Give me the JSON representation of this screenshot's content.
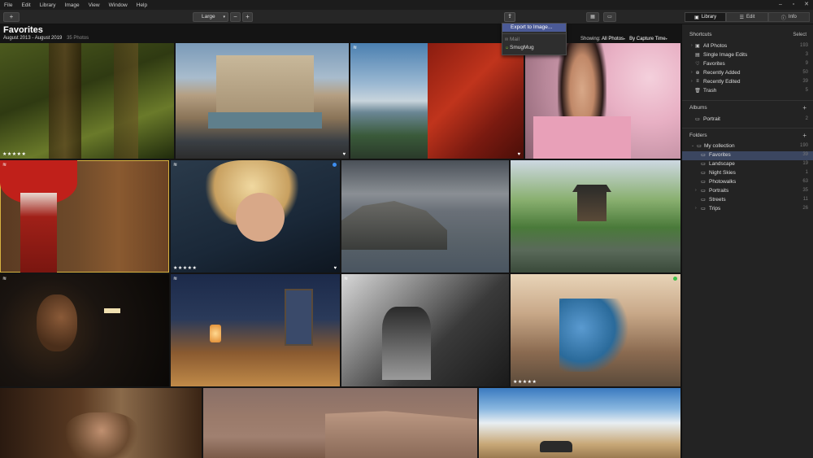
{
  "menubar": {
    "items": [
      "File",
      "Edit",
      "Library",
      "Image",
      "View",
      "Window",
      "Help"
    ]
  },
  "toolbar": {
    "add_label": "+",
    "size_value": "Large",
    "zoom_out": "−",
    "zoom_in": "+"
  },
  "tabs": [
    {
      "label": "Library",
      "icon": "library-icon"
    },
    {
      "label": "Edit",
      "icon": "sliders-icon"
    },
    {
      "label": "Info",
      "icon": "info-icon"
    }
  ],
  "header": {
    "title": "Favorites",
    "date_range": "August 2013 - August 2019",
    "count": "35 Photos",
    "showing_label": "Showing:",
    "showing_value": "All Photos",
    "sort_value": "By Capture Time"
  },
  "export_menu": {
    "items": [
      "Export to Image...",
      "Mail",
      "SmugMug"
    ]
  },
  "sidebar": {
    "shortcuts": {
      "title": "Shortcuts",
      "action": "Select",
      "items": [
        {
          "label": "All Photos",
          "count": "193"
        },
        {
          "label": "Single Image Edits",
          "count": "3"
        },
        {
          "label": "Favorites",
          "count": "9"
        },
        {
          "label": "Recently Added",
          "count": "50"
        },
        {
          "label": "Recently Edited",
          "count": "39"
        },
        {
          "label": "Trash",
          "count": "5"
        }
      ]
    },
    "albums": {
      "title": "Albums",
      "action": "+",
      "items": [
        {
          "label": "Portrait",
          "count": "2"
        }
      ]
    },
    "folders": {
      "title": "Folders",
      "action": "+",
      "items": [
        {
          "label": "My collection",
          "count": "190"
        },
        {
          "label": "Favorites",
          "count": "39"
        },
        {
          "label": "Landscape",
          "count": "19"
        },
        {
          "label": "Night Skies",
          "count": "1"
        },
        {
          "label": "Photowalks",
          "count": "63"
        },
        {
          "label": "Portraits",
          "count": "35"
        },
        {
          "label": "Streets",
          "count": "11"
        },
        {
          "label": "Trips",
          "count": "26"
        }
      ]
    }
  },
  "photos": [
    {
      "subject": "mossy-forest",
      "rating": "★★★★★",
      "favorite": false
    },
    {
      "subject": "trevi-fountain",
      "rating": "",
      "favorite": true
    },
    {
      "subject": "red-pagoda-lake",
      "rating": "",
      "favorite": true
    },
    {
      "subject": "woman-cherry-blossom",
      "rating": "",
      "favorite": false
    },
    {
      "subject": "geisha-red-umbrella",
      "rating": "",
      "favorite": false
    },
    {
      "subject": "blonde-portrait",
      "rating": "★★★★★",
      "favorite": true
    },
    {
      "subject": "city-aerial",
      "rating": "",
      "favorite": false
    },
    {
      "subject": "japanese-temple-garden",
      "rating": "",
      "favorite": false
    },
    {
      "subject": "man-dark-portrait",
      "rating": "",
      "favorite": false
    },
    {
      "subject": "desert-room-lantern",
      "rating": "",
      "favorite": false
    },
    {
      "subject": "man-driving-bw",
      "rating": "",
      "favorite": false
    },
    {
      "subject": "couple-bicycles",
      "rating": "★★★★★",
      "favorite": false
    },
    {
      "subject": "children-dark",
      "rating": "",
      "favorite": false
    },
    {
      "subject": "canyon-cliff",
      "rating": "",
      "favorite": false
    },
    {
      "subject": "car-blue-sky",
      "rating": "",
      "favorite": false
    }
  ],
  "colors": {
    "accent": "#4b5a96",
    "selection": "#3b4660",
    "blue_tag": "#3d8ef0",
    "green_tag": "#3fbf4a",
    "sel_border": "#d8b240"
  }
}
